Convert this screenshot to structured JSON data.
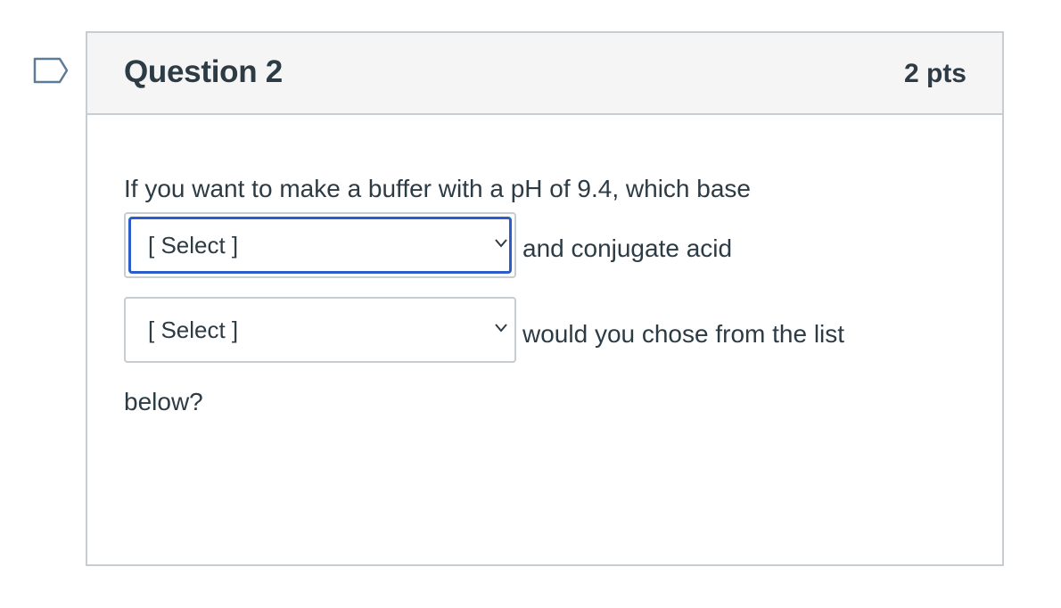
{
  "flag": {
    "icon": "bookmark-flag-icon",
    "color": "#5d7b96"
  },
  "question": {
    "title": "Question 2",
    "points": "2 pts",
    "text_before_select1": "If you want to make a buffer with a pH of 9.4, which base",
    "text_after_select1": "and conjugate acid",
    "text_after_select2": "would you chose from the list",
    "text_end": "below?",
    "select1": {
      "value": "[ Select ]",
      "focused": true
    },
    "select2": {
      "value": "[ Select ]",
      "focused": false
    }
  },
  "colors": {
    "border": "#c7cdd1",
    "header_bg": "#f5f5f5",
    "text": "#2d3b45",
    "focus": "#2b5cc9"
  }
}
